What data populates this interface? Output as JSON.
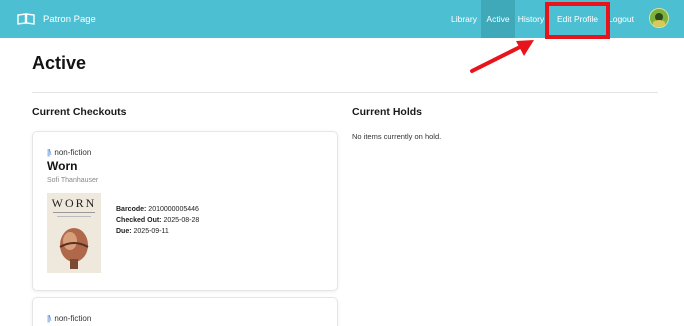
{
  "header": {
    "brand": "Patron Page",
    "nav": [
      {
        "label": "Library"
      },
      {
        "label": "Active",
        "active": true
      },
      {
        "label": "History"
      },
      {
        "label": "Edit Profile"
      },
      {
        "label": "Logout"
      }
    ]
  },
  "page": {
    "title": "Active"
  },
  "checkouts": {
    "title": "Current Checkouts",
    "items": [
      {
        "category": "non-fiction",
        "title": "Worn",
        "author": "Sofi Thanhauser",
        "cover_title": "WORN",
        "barcode_label": "Barcode:",
        "barcode": "2010000005446",
        "checked_out_label": "Checked Out:",
        "checked_out": "2025-08-28",
        "due_label": "Due:",
        "due": "2025-09-11"
      },
      {
        "category": "non-fiction"
      }
    ]
  },
  "holds": {
    "title": "Current Holds",
    "empty_message": "No items currently on hold."
  },
  "colors": {
    "navbar": "#4cc0d2",
    "nav_active": "#3fa9ba",
    "annotation": "#e8141c"
  }
}
